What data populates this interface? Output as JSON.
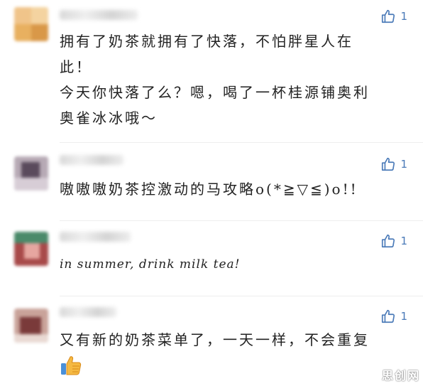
{
  "comments": [
    {
      "likes": "1",
      "text_lines": [
        "拥有了奶茶就拥有了快落，不怕胖星人在",
        "此！",
        "今天你快落了么？嗯，喝了一杯桂源铺奥利",
        "奥雀冰冰哦～"
      ]
    },
    {
      "likes": "1",
      "text_lines": [
        "嗷嗷嗷奶茶控激动的马攻略o(*≧▽≦)o!!"
      ]
    },
    {
      "likes": "1",
      "text_lines": [
        "in summer, drink milk tea!"
      ]
    },
    {
      "likes": "1",
      "text_lines": [
        "又有新的奶茶菜单了，一天一样，不会重复"
      ],
      "emoji": "thumbs-up"
    }
  ],
  "icons": {
    "like": "thumbs-up-outline-icon",
    "emoji": "thumbs-up-emoji-icon"
  },
  "colors": {
    "like": "#4a7ab8",
    "text": "#222222"
  },
  "watermark": "思创网"
}
